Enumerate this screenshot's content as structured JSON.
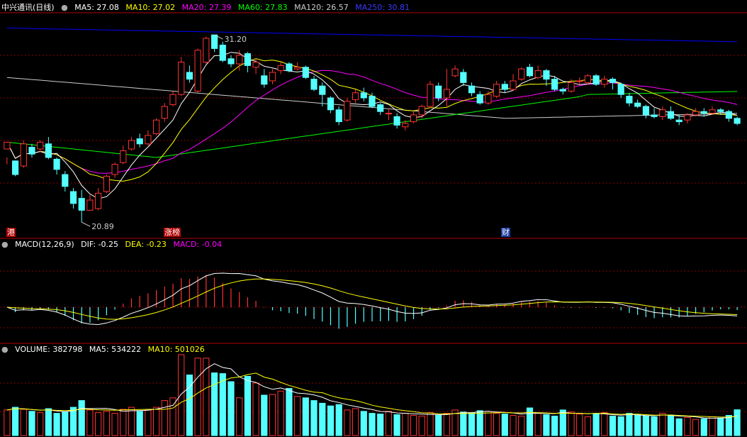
{
  "header": {
    "stock": "中兴通讯(日线)",
    "ma": [
      {
        "label": "MA5: 27.08",
        "color": "#ffffff"
      },
      {
        "label": "MA10: 27.02",
        "color": "#ffff00"
      },
      {
        "label": "MA20: 27.39",
        "color": "#ff00ff"
      },
      {
        "label": "MA60: 27.83",
        "color": "#00ff00"
      },
      {
        "label": "MA120: 26.57",
        "color": "#cccccc"
      },
      {
        "label": "MA250: 30.81",
        "color": "#0000ff"
      }
    ]
  },
  "macd_header": {
    "title": "MACD(12,26,9)",
    "dif": "DIF: -0.25",
    "dea": "DEA: -0.23",
    "macd": "MACD: -0.04"
  },
  "volume_header": {
    "title": "VOLUME: 382798",
    "ma5": "MA5: 534222",
    "ma10": "MA10: 501026"
  },
  "markers": {
    "high_label": "31.20",
    "low_label": "20.89",
    "tag_left": "港",
    "tag_mid": "涨榜",
    "tag_right": "财"
  },
  "colors": {
    "up": "#ff3232",
    "down": "#54ffff",
    "ma5": "#ffffff",
    "ma10": "#ffff00",
    "ma20": "#ff00ff",
    "ma60": "#00ff00",
    "ma120": "#cccccc",
    "ma250": "#0000ff",
    "grid": "#8b0000"
  },
  "chart_data": {
    "type": "candlestick",
    "price_range": [
      20.0,
      32.5
    ],
    "candles": [
      [
        24.5,
        24.9,
        24.0,
        23.6
      ],
      [
        23.8,
        23.0,
        22.9,
        23.0
      ],
      [
        23.5,
        24.8,
        25.0,
        23.4
      ],
      [
        24.6,
        24.2,
        24.8,
        24.0
      ],
      [
        24.5,
        24.9,
        25.0,
        24.3
      ],
      [
        24.8,
        24.0,
        25.2,
        23.9
      ],
      [
        23.9,
        23.3,
        24.0,
        23.0
      ],
      [
        23.0,
        22.3,
        23.2,
        22.0
      ],
      [
        22.0,
        21.3,
        22.2,
        21.0
      ],
      [
        21.6,
        20.9,
        22.1,
        20.2
      ],
      [
        20.9,
        21.5,
        21.8,
        20.89
      ],
      [
        21.0,
        21.9,
        22.2,
        20.9
      ],
      [
        22.0,
        22.9,
        23.0,
        21.9
      ],
      [
        23.0,
        23.6,
        23.7,
        22.8
      ],
      [
        23.7,
        24.4,
        24.7,
        23.6
      ],
      [
        24.5,
        25.0,
        25.2,
        24.4
      ],
      [
        25.1,
        24.8,
        25.4,
        24.6
      ],
      [
        24.8,
        25.3,
        25.6,
        24.7
      ],
      [
        25.4,
        26.2,
        26.3,
        25.3
      ],
      [
        26.3,
        27.0,
        27.2,
        26.1
      ],
      [
        27.1,
        27.7,
        27.9,
        27.0
      ],
      [
        27.7,
        29.6,
        29.9,
        27.6
      ],
      [
        29.0,
        28.6,
        29.4,
        28.4
      ],
      [
        27.9,
        30.3,
        30.4,
        27.8
      ],
      [
        29.6,
        31.0,
        31.1,
        29.5
      ],
      [
        31.2,
        30.4,
        31.2,
        30.2
      ],
      [
        30.6,
        29.7,
        30.8,
        29.6
      ],
      [
        29.8,
        29.5,
        30.0,
        29.3
      ],
      [
        29.5,
        30.0,
        30.3,
        29.1
      ],
      [
        30.1,
        29.4,
        30.2,
        29.0
      ],
      [
        29.3,
        29.6,
        29.8,
        28.9
      ],
      [
        28.8,
        28.3,
        29.2,
        28.1
      ],
      [
        28.5,
        29.0,
        29.2,
        28.3
      ],
      [
        29.1,
        29.4,
        29.6,
        28.9
      ],
      [
        29.5,
        29.1,
        29.6,
        29.0
      ],
      [
        29.2,
        29.3,
        29.6,
        29.1
      ],
      [
        29.3,
        28.7,
        29.4,
        28.6
      ],
      [
        28.6,
        28.0,
        28.8,
        27.9
      ],
      [
        28.2,
        27.7,
        28.4,
        27.0
      ],
      [
        27.5,
        26.8,
        27.6,
        26.6
      ],
      [
        26.8,
        26.1,
        27.0,
        25.9
      ],
      [
        26.2,
        27.3,
        27.5,
        26.1
      ],
      [
        27.4,
        27.8,
        28.0,
        27.2
      ],
      [
        27.8,
        27.5,
        28.1,
        27.3
      ],
      [
        27.6,
        27.0,
        27.8,
        26.9
      ],
      [
        27.1,
        26.7,
        27.2,
        26.5
      ],
      [
        26.6,
        26.6,
        26.9,
        26.2
      ],
      [
        26.4,
        25.9,
        26.6,
        25.7
      ],
      [
        25.8,
        26.0,
        26.2,
        25.6
      ],
      [
        26.1,
        26.5,
        26.7,
        26.0
      ],
      [
        26.5,
        27.0,
        27.1,
        26.3
      ],
      [
        27.0,
        28.3,
        28.5,
        26.9
      ],
      [
        28.2,
        27.5,
        28.4,
        27.3
      ],
      [
        27.5,
        28.0,
        29.2,
        27.0
      ],
      [
        28.8,
        29.2,
        29.4,
        28.7
      ],
      [
        29.0,
        28.4,
        29.2,
        28.2
      ],
      [
        28.2,
        27.8,
        28.4,
        27.6
      ],
      [
        27.7,
        27.2,
        27.9,
        27.1
      ],
      [
        27.2,
        27.7,
        27.9,
        27.1
      ],
      [
        27.6,
        28.3,
        28.5,
        27.5
      ],
      [
        28.3,
        28.0,
        28.5,
        27.8
      ],
      [
        28.0,
        28.5,
        28.9,
        27.9
      ],
      [
        28.6,
        29.2,
        29.3,
        28.5
      ],
      [
        29.3,
        28.8,
        29.5,
        28.7
      ],
      [
        28.7,
        29.1,
        29.4,
        28.6
      ],
      [
        29.1,
        28.6,
        29.2,
        28.2
      ],
      [
        28.6,
        28.0,
        28.8,
        27.9
      ],
      [
        28.0,
        27.9,
        28.1,
        27.7
      ],
      [
        27.9,
        28.4,
        28.6,
        27.8
      ],
      [
        28.5,
        28.5,
        28.7,
        28.3
      ],
      [
        28.4,
        28.8,
        28.9,
        28.3
      ],
      [
        28.8,
        28.3,
        28.9,
        28.2
      ],
      [
        28.3,
        28.6,
        28.8,
        28.1
      ],
      [
        28.6,
        28.4,
        28.7,
        28.0
      ],
      [
        28.3,
        27.7,
        28.4,
        27.5
      ],
      [
        27.6,
        27.2,
        27.8,
        27.0
      ],
      [
        27.2,
        27.0,
        27.4,
        26.9
      ],
      [
        27.0,
        26.5,
        27.1,
        26.3
      ],
      [
        26.5,
        26.4,
        26.9,
        26.3
      ],
      [
        26.4,
        26.8,
        27.0,
        26.2
      ],
      [
        26.7,
        26.3,
        27.0,
        26.2
      ],
      [
        26.2,
        26.1,
        26.5,
        25.9
      ],
      [
        26.2,
        26.5,
        26.6,
        26.0
      ],
      [
        26.5,
        26.7,
        26.9,
        26.4
      ],
      [
        26.7,
        26.6,
        26.9,
        26.4
      ],
      [
        26.6,
        26.8,
        27.0,
        26.5
      ],
      [
        26.8,
        26.7,
        26.9,
        26.5
      ],
      [
        26.7,
        26.3,
        26.8,
        26.1
      ],
      [
        26.3,
        26.0,
        26.4,
        25.9
      ]
    ],
    "volume": [
      380,
      420,
      390,
      360,
      340,
      400,
      330,
      350,
      420,
      520,
      380,
      340,
      360,
      330,
      390,
      420,
      360,
      380,
      420,
      520,
      560,
      1200,
      900,
      1150,
      1150,
      930,
      920,
      800,
      560,
      880,
      780,
      600,
      610,
      660,
      700,
      580,
      560,
      520,
      480,
      440,
      460,
      380,
      400,
      360,
      330,
      320,
      360,
      310,
      330,
      300,
      290,
      340,
      300,
      330,
      380,
      350,
      340,
      370,
      360,
      330,
      320,
      300,
      290,
      410,
      330,
      310,
      290,
      380,
      350,
      320,
      280,
      320,
      340,
      290,
      280,
      330,
      300,
      290,
      280,
      330,
      300,
      250,
      270,
      240,
      250,
      280,
      260,
      300,
      383
    ],
    "volume_range": [
      0,
      1200
    ]
  }
}
